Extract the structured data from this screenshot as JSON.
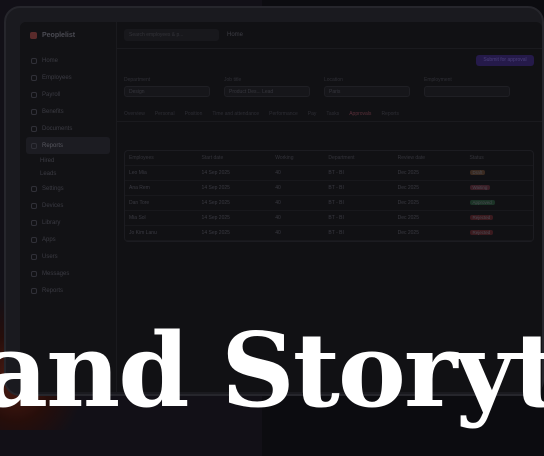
{
  "headline": "and Storyt",
  "app": {
    "logo_text": "Peoplelist",
    "search_placeholder": "Search employees & p...",
    "breadcrumb": "Home",
    "cta_label": "Submit for approval",
    "nav": [
      {
        "label": "Home",
        "active": false
      },
      {
        "label": "Employees",
        "active": false
      },
      {
        "label": "Payroll",
        "active": false
      },
      {
        "label": "Benefits",
        "active": false
      },
      {
        "label": "Documents",
        "active": false
      },
      {
        "label": "Reports",
        "active": true
      },
      {
        "label": "Hired",
        "active": false,
        "sub": true
      },
      {
        "label": "Leads",
        "active": false,
        "sub": true
      },
      {
        "label": "Settings",
        "active": false
      },
      {
        "label": "Devices",
        "active": false
      },
      {
        "label": "Library",
        "active": false
      },
      {
        "label": "Apps",
        "active": false
      },
      {
        "label": "Users",
        "active": false
      },
      {
        "label": "Messages",
        "active": false
      },
      {
        "label": "Reports",
        "active": false
      }
    ],
    "filters": [
      {
        "label": "Department",
        "value": "Design"
      },
      {
        "label": "Job title",
        "value": "Product Des... Lead"
      },
      {
        "label": "Location",
        "value": "Paris"
      },
      {
        "label": "Employment",
        "value": ""
      }
    ],
    "tabs": [
      "Overview",
      "Personal",
      "Position",
      "Time and attendance",
      "Performance",
      "Pay",
      "Tasks",
      "Approvals",
      "Reports"
    ],
    "active_tab": "Approvals",
    "table": {
      "headers": [
        "Employees",
        "Start date",
        "Working",
        "Department",
        "Review date",
        "Status"
      ],
      "rows": [
        {
          "name": "Leo Mia",
          "date": "14 Sep 2025",
          "hours": "40",
          "dept": "BT - BI",
          "review": "Dec 2025",
          "status": "Draft"
        },
        {
          "name": "Ana Rem",
          "date": "14 Sep 2025",
          "hours": "40",
          "dept": "BT - BI",
          "review": "Dec 2025",
          "status": "Waiting"
        },
        {
          "name": "Dan Tore",
          "date": "14 Sep 2025",
          "hours": "40",
          "dept": "BT - BI",
          "review": "Dec 2025",
          "status": "Approved"
        },
        {
          "name": "Mia Sol",
          "date": "14 Sep 2025",
          "hours": "40",
          "dept": "BT - BI",
          "review": "Dec 2025",
          "status": "Rejected"
        },
        {
          "name": "Jo Kim Lanu",
          "date": "14 Sep 2025",
          "hours": "40",
          "dept": "BT - BI",
          "review": "Dec 2025",
          "status": "Rejected"
        }
      ]
    }
  },
  "colors": {
    "headline": "#ffffff",
    "accent": "#251a4a"
  }
}
